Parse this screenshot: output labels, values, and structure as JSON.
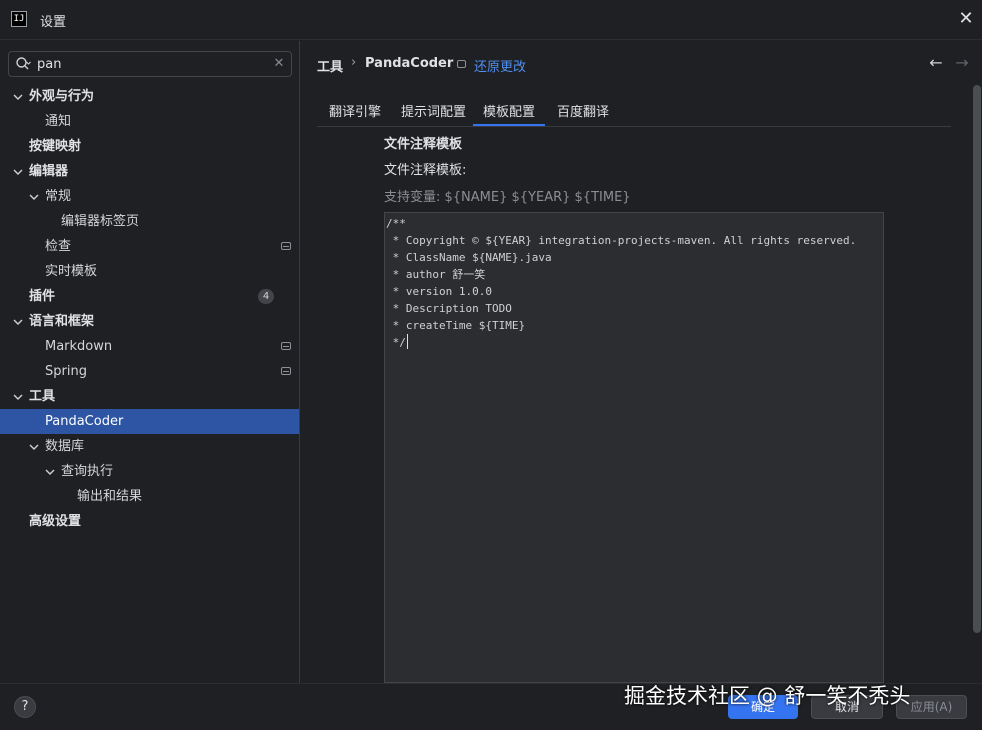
{
  "window": {
    "title": "设置",
    "icon_text": "IJ"
  },
  "search": {
    "value": "pan"
  },
  "tree": {
    "appearance": "外观与行为",
    "notifications": "通知",
    "keymap": "按键映射",
    "editor": "编辑器",
    "general": "常规",
    "editor_tabs": "编辑器标签页",
    "inspections": "检查",
    "live_templates": "实时模板",
    "plugins": "插件",
    "plugins_count": "4",
    "languages": "语言和框架",
    "markdown": "Markdown",
    "spring": "Spring",
    "tools": "工具",
    "pandacoder": "PandaCoder",
    "database": "数据库",
    "query_execution": "查询执行",
    "output_results": "输出和结果",
    "advanced": "高级设置"
  },
  "breadcrumb": {
    "parent": "工具",
    "separator": "›",
    "current": "PandaCoder",
    "restore": "还原更改"
  },
  "nav": {
    "back": "←",
    "forward": "→"
  },
  "tabs": [
    "翻译引擎",
    "提示词配置",
    "模板配置",
    "百度翻译"
  ],
  "section": {
    "title": "文件注释模板",
    "field_label": "文件注释模板:",
    "hint": "支持变量: ${NAME} ${YEAR} ${TIME}"
  },
  "editor": {
    "text": "/**\n * Copyright © ${YEAR} integration-projects-maven. All rights reserved.\n * ClassName ${NAME}.java\n * author 舒一笑\n * version 1.0.0\n * Description TODO\n * createTime ${TIME}\n */"
  },
  "footer": {
    "help": "?",
    "ok": "确定",
    "cancel": "取消",
    "apply": "应用(A)",
    "watermark": "掘金技术社区 @ 舒一笑不秃头"
  },
  "colors": {
    "accent": "#3574f0",
    "link": "#4f8ff0",
    "selection": "#2e55a3",
    "background": "#1f2023"
  }
}
